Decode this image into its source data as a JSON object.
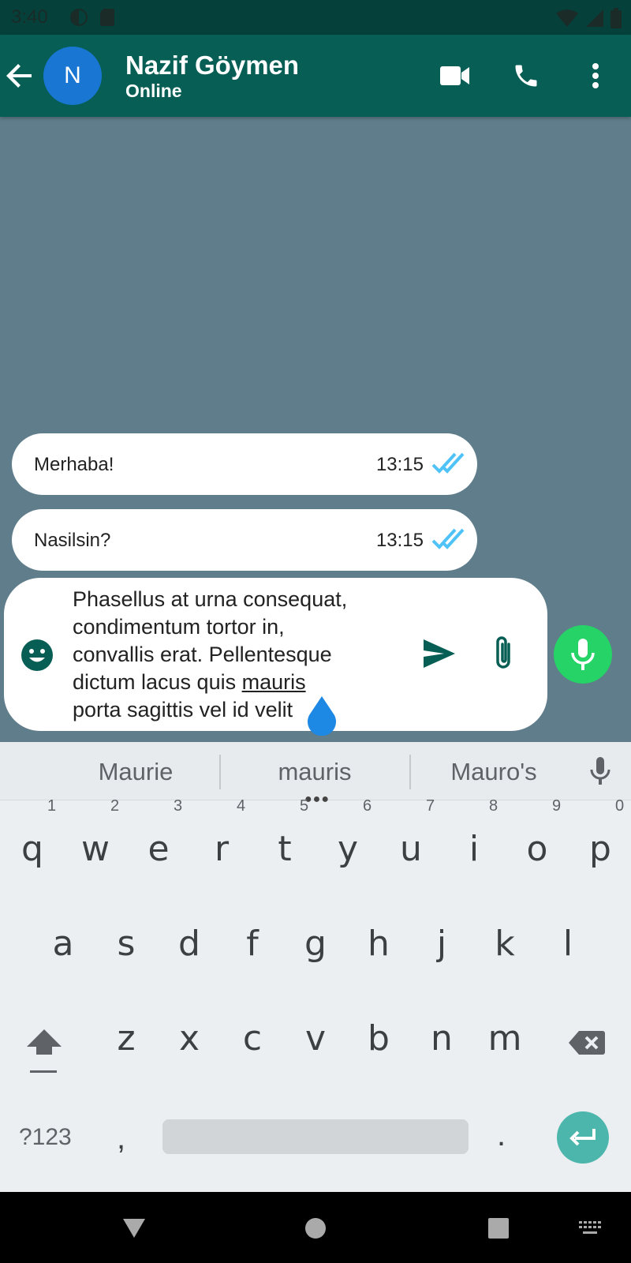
{
  "status_bar": {
    "time": "3:40"
  },
  "app_bar": {
    "contact_initial": "N",
    "contact_name": "Nazif Göymen",
    "contact_status": "Online"
  },
  "messages": [
    {
      "text": "Merhaba!",
      "time": "13:15",
      "status_icon": "double-check-icon"
    },
    {
      "text": "Nasilsin?",
      "time": "13:15",
      "status_icon": "double-check-icon"
    }
  ],
  "composer": {
    "line1": "Phasellus at urna consequat,",
    "line2": "condimentum tortor in,",
    "line3": "convallis erat. Pellentesque",
    "line4_prefix": "dictum lacus quis ",
    "line4_underlined": "mauris",
    "line5": "porta sagittis vel id velit"
  },
  "keyboard": {
    "suggestions": [
      "Maurie",
      "mauris",
      "Mauro's"
    ],
    "row1": [
      "q",
      "w",
      "e",
      "r",
      "t",
      "y",
      "u",
      "i",
      "o",
      "p"
    ],
    "row1_hints": [
      "1",
      "2",
      "3",
      "4",
      "5",
      "6",
      "7",
      "8",
      "9",
      "0"
    ],
    "row2": [
      "a",
      "s",
      "d",
      "f",
      "g",
      "h",
      "j",
      "k",
      "l"
    ],
    "row3": [
      "z",
      "x",
      "c",
      "v",
      "b",
      "n",
      "m"
    ],
    "symbols_key": "?123",
    "comma_key": ",",
    "period_key": "."
  },
  "colors": {
    "app_bar": "#075e54",
    "status_bar": "#05403a",
    "chat_background": "#607d8b",
    "avatar": "#1976d2",
    "mic_fab": "#25d366",
    "enter_key": "#4db6ac",
    "read_receipt": "#4fc3f7"
  }
}
